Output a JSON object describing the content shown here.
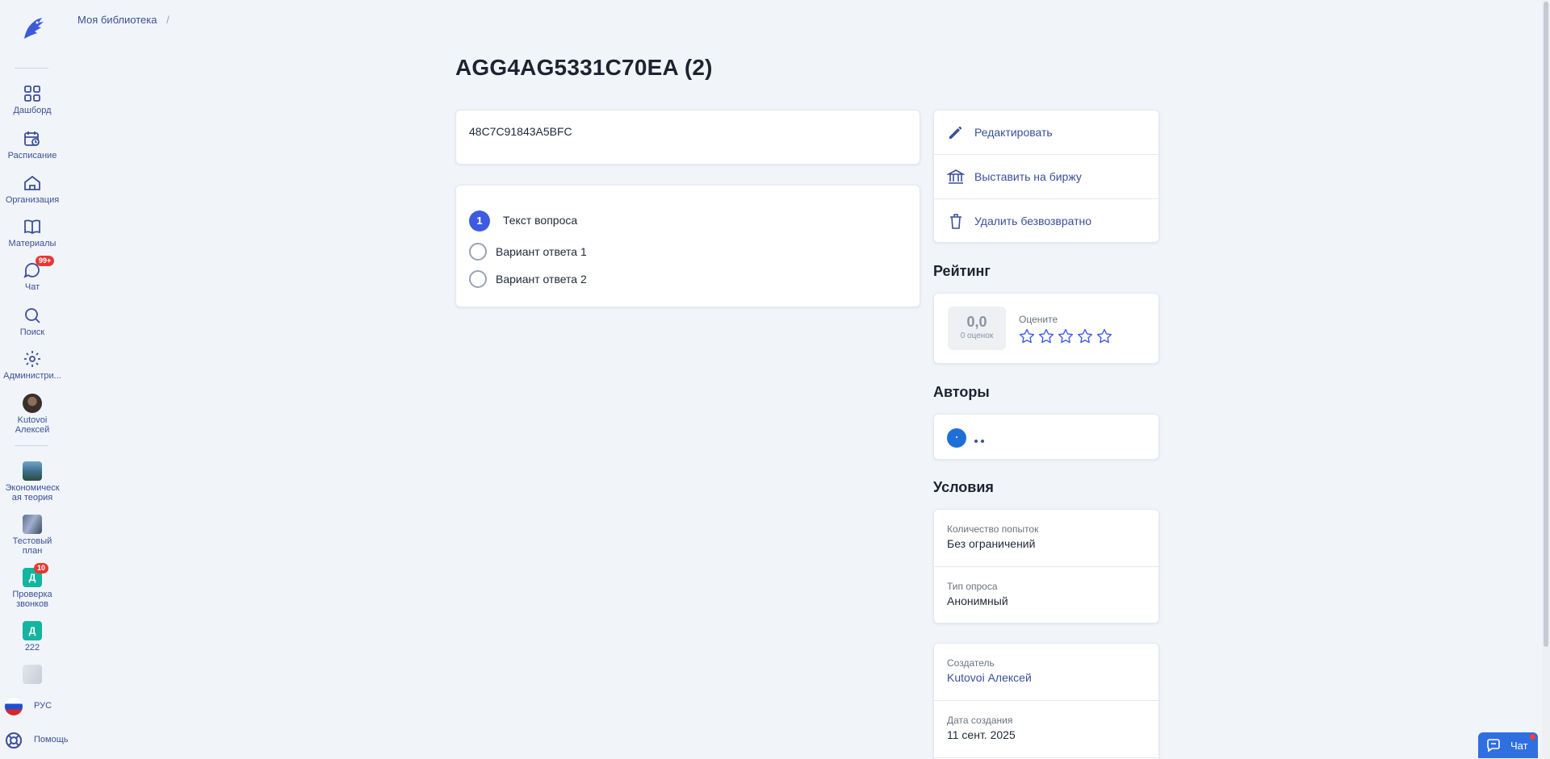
{
  "breadcrumb": {
    "root": "Моя библиотека",
    "separator": "/"
  },
  "page": {
    "title": "AGG4AG5331C70EA (2)",
    "code": "48C7C91843A5BFC"
  },
  "question": {
    "number": "1",
    "text": "Текст вопроса",
    "options": [
      "Вариант ответа 1",
      "Вариант ответа 2"
    ]
  },
  "actions": {
    "edit": "Редактировать",
    "exchange": "Выставить на биржу",
    "delete": "Удалить безвозвратно"
  },
  "rating": {
    "heading": "Рейтинг",
    "score": "0,0",
    "count": "0 оценок",
    "rate_label": "Оцените",
    "stars_total": 5
  },
  "authors": {
    "heading": "Авторы"
  },
  "conditions": {
    "heading": "Условия",
    "attempts_label": "Количество попыток",
    "attempts_value": "Без ограничений",
    "type_label": "Тип опроса",
    "type_value": "Анонимный"
  },
  "meta": {
    "creator_label": "Создатель",
    "creator_value": "Kutovoi Алексей",
    "created_label": "Дата создания",
    "created_value": "11 сент. 2025"
  },
  "sidebar": {
    "items": [
      {
        "label": "Дашборд",
        "icon": "dashboard-icon"
      },
      {
        "label": "Расписание",
        "icon": "calendar-icon"
      },
      {
        "label": "Организация",
        "icon": "home-icon"
      },
      {
        "label": "Материалы",
        "icon": "book-icon"
      },
      {
        "label": "Чат",
        "icon": "chat-icon",
        "badge": "99+"
      },
      {
        "label": "Поиск",
        "icon": "search-icon"
      },
      {
        "label": "Администри...",
        "icon": "gear-icon"
      }
    ],
    "user": {
      "name_line1": "Kutovoi",
      "name_line2": "Алексей"
    },
    "courses": [
      {
        "line1": "Экономическ",
        "line2": "ая теория"
      },
      {
        "line1": "Тестовый",
        "line2": "план"
      },
      {
        "line1": "Проверка",
        "line2": "звонков",
        "letter": "Д",
        "badge": "10"
      },
      {
        "line1": "222",
        "letter": "Д"
      }
    ],
    "language": "РУС",
    "help": "Помощь"
  },
  "chat_button": {
    "label": "Чат"
  },
  "colors": {
    "accent": "#3d5be0",
    "link": "#3b4f9a",
    "badge": "#e53935",
    "chat": "#2f6fe0"
  }
}
